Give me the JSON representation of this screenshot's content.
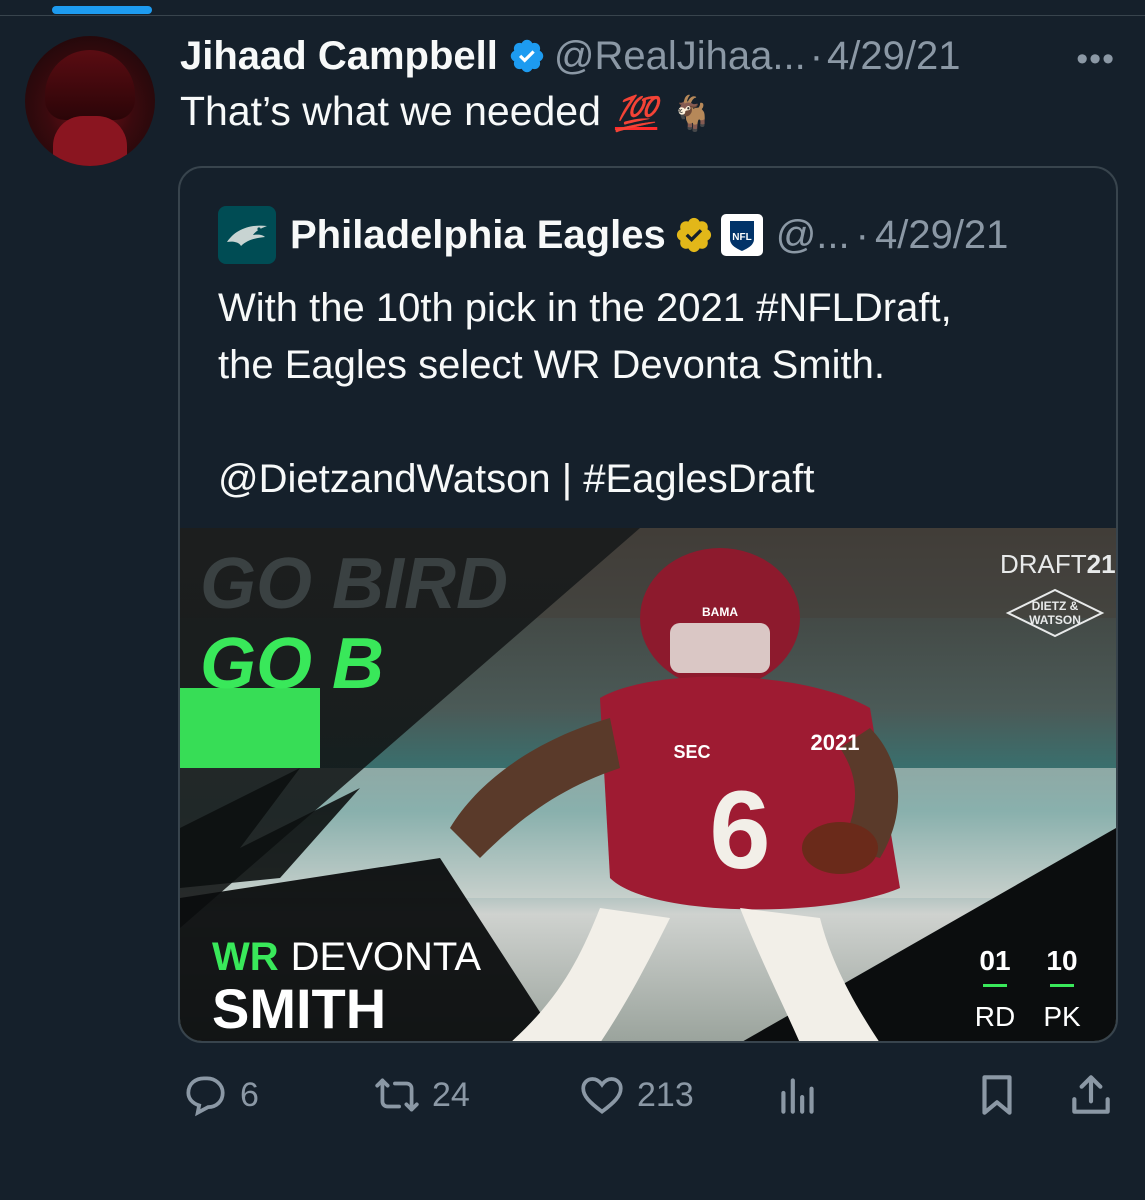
{
  "tweet": {
    "author_name": "Jihaad Campbell",
    "author_handle": "@RealJihaa...",
    "separator": "·",
    "date": "4/29/21",
    "text": "That’s what we needed",
    "emoji_1": "💯",
    "emoji_2": "🐐",
    "more_label": "•••"
  },
  "quoted_tweet": {
    "author_name": "Philadelphia Eagles",
    "author_handle": "@...",
    "separator": "·",
    "date": "4/29/21",
    "lines": [
      "With the 10th pick in the 2021 #NFLDraft,",
      "the Eagles select WR Devonta Smith.",
      "",
      "@DietzandWatson | #EaglesDraft"
    ],
    "nfl_badge": "NFL"
  },
  "media": {
    "bg_text_1": "GO BIRD",
    "bg_text_2": "GO B",
    "brand": "DRAFT",
    "brand_year": "21",
    "sponsor_line_1": "DIETZ &",
    "sponsor_line_2": "WATSON",
    "position": "WR",
    "first_name": "DEVONTA",
    "last_name": "SMITH",
    "round_value": "01",
    "pick_value": "10",
    "round_label": "RD",
    "pick_label": "PK",
    "jersey_number": "6",
    "jersey_year": "2021",
    "helmet_text": "BAMA",
    "patch_text": "SEC",
    "accent_color": "#39e85a",
    "jersey_color": "#9e1b32"
  },
  "actions": {
    "replies": "6",
    "retweets": "24",
    "likes": "213"
  },
  "colors": {
    "background": "#15202b",
    "text": "#f7f9f9",
    "muted": "#8b98a5",
    "border": "#38444d",
    "verified_blue": "#1d9bf0",
    "verified_gold": "#e2b719"
  }
}
